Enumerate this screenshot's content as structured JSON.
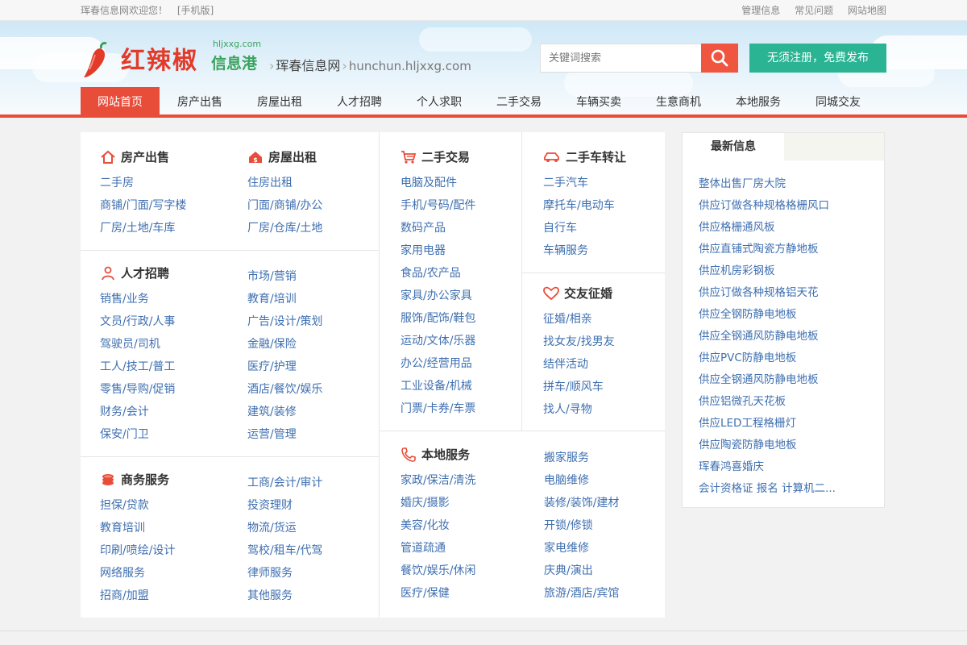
{
  "topbar": {
    "welcome": "珲春信息网欢迎您！",
    "mobile": "[手机版]",
    "links": [
      "管理信息",
      "常见问题",
      "网站地图"
    ]
  },
  "header": {
    "brand": "红辣椒",
    "brand2": "信息港",
    "domain_small": "hljxxg.com",
    "city_name": "珲春信息网",
    "city_url": "hunchun.hljxxg.com",
    "search_placeholder": "关键词搜索",
    "post_button": "无须注册，免费发布"
  },
  "nav": [
    "网站首页",
    "房产出售",
    "房屋出租",
    "人才招聘",
    "个人求职",
    "二手交易",
    "车辆买卖",
    "生意商机",
    "本地服务",
    "同城交友"
  ],
  "sections": {
    "house_sale": {
      "title": "房产出售",
      "items": [
        "二手房",
        "商铺/门面/写字楼",
        "厂房/土地/车库"
      ]
    },
    "house_rent": {
      "title": "房屋出租",
      "items": [
        "住房出租",
        "门面/商铺/办公",
        "厂房/仓库/土地"
      ]
    },
    "jobs": {
      "title": "人才招聘",
      "left": [
        "销售/业务",
        "文员/行政/人事",
        "驾驶员/司机",
        "工人/技工/普工",
        "零售/导购/促销",
        "财务/会计",
        "保安/门卫"
      ],
      "right": [
        "市场/营销",
        "教育/培训",
        "广告/设计/策划",
        "金融/保险",
        "医疗/护理",
        "酒店/餐饮/娱乐",
        "建筑/装修",
        "运营/管理"
      ]
    },
    "business": {
      "title": "商务服务",
      "left": [
        "担保/贷款",
        "教育培训",
        "印刷/喷绘/设计",
        "网络服务",
        "招商/加盟"
      ],
      "right": [
        "工商/会计/审计",
        "投资理财",
        "物流/货运",
        "驾校/租车/代驾",
        "律师服务",
        "其他服务"
      ]
    },
    "second_hand": {
      "title": "二手交易",
      "items": [
        "电脑及配件",
        "手机/号码/配件",
        "数码产品",
        "家用电器",
        "食品/农产品",
        "家具/办公家具",
        "服饰/配饰/鞋包",
        "运动/文体/乐器",
        "办公/经营用品",
        "工业设备/机械",
        "门票/卡券/车票"
      ]
    },
    "used_car": {
      "title": "二手车转让",
      "items": [
        "二手汽车",
        "摩托车/电动车",
        "自行车",
        "车辆服务"
      ]
    },
    "dating": {
      "title": "交友征婚",
      "items": [
        "征婚/相亲",
        "找女友/找男友",
        "结伴活动",
        "拼车/顺风车",
        "找人/寻物"
      ]
    },
    "local": {
      "title": "本地服务",
      "left": [
        "家政/保洁/清洗",
        "婚庆/摄影",
        "美容/化妆",
        "管道疏通",
        "餐饮/娱乐/休闲",
        "医疗/保健"
      ],
      "right": [
        "搬家服务",
        "电脑维修",
        "装修/装饰/建材",
        "开锁/修锁",
        "家电维修",
        "庆典/演出",
        "旅游/酒店/宾馆"
      ]
    }
  },
  "latest": {
    "title": "最新信息",
    "items": [
      "整体出售厂房大院",
      "供应订做各种规格格栅风口",
      "供应格栅通风板",
      "供应直铺式陶瓷方静地板",
      "供应机房彩钢板",
      "供应订做各种规格铝天花",
      "供应全钢防静电地板",
      "供应全钢通风防静电地板",
      "供应PVC防静电地板",
      "供应全钢通风防静电地板",
      "供应铝微孔天花板",
      "供应LED工程格栅灯",
      "供应陶瓷防静电地板",
      "珲春鸿喜婚庆",
      "会计资格证 报名 计算机二..."
    ]
  },
  "colors": {
    "accent": "#e84d3a",
    "link": "#3e6fb0",
    "post": "#2bb494",
    "brand_green": "#3aa35d"
  }
}
